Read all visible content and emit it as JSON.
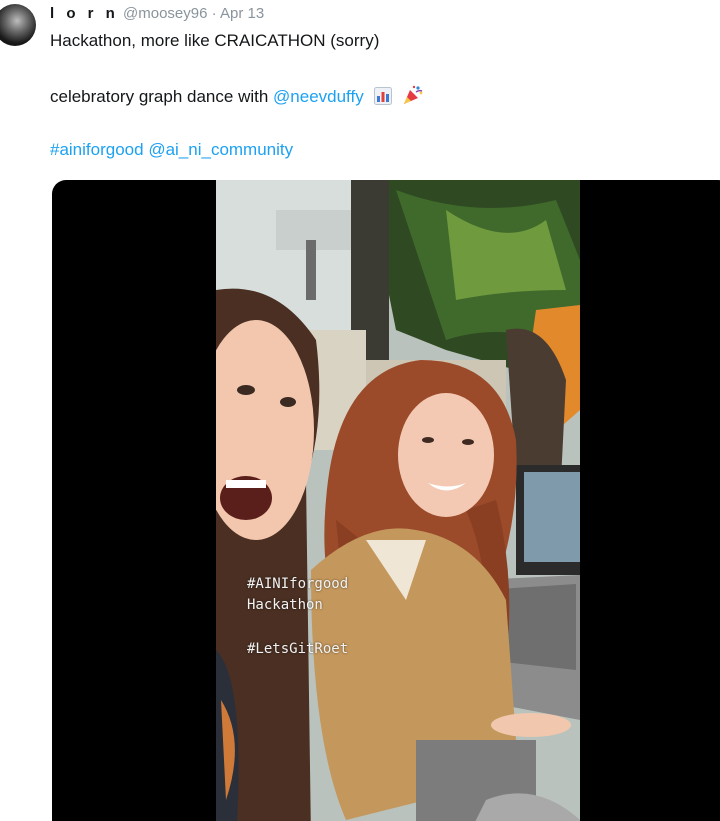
{
  "tweet": {
    "display_name": "l o r n",
    "handle": "@moosey96",
    "separator": "·",
    "date": "Apr 13",
    "line1": "Hackathon, more like CRAICATHON (sorry)",
    "line2_text": "celebratory graph dance with",
    "line2_mention": "@neevduffy",
    "line3_hashtag": "#ainiforgood",
    "line3_mention": "@ai_ni_community",
    "emojis": [
      "bar-chart-icon",
      "party-popper-icon"
    ]
  },
  "video": {
    "overlay_line1": "#AINIforgood",
    "overlay_line2": "Hackathon",
    "overlay_line3": "#LetsGitRoet"
  }
}
